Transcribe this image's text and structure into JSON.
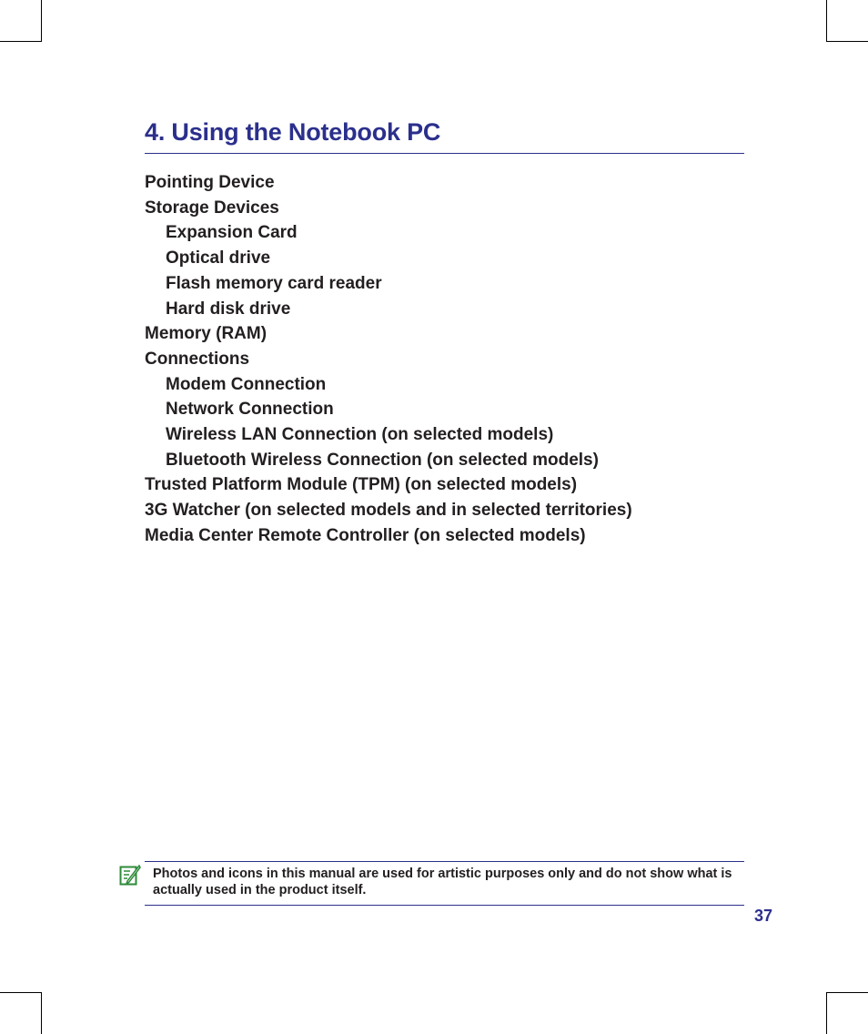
{
  "page": {
    "chapter_title": "4. Using the Notebook PC",
    "toc": [
      {
        "label": "Pointing Device",
        "level": 1
      },
      {
        "label": "Storage Devices",
        "level": 1
      },
      {
        "label": "Expansion Card",
        "level": 2
      },
      {
        "label": "Optical drive",
        "level": 2
      },
      {
        "label": "Flash memory card reader",
        "level": 2
      },
      {
        "label": "Hard disk drive",
        "level": 2
      },
      {
        "label": "Memory (RAM)",
        "level": 1
      },
      {
        "label": "Connections",
        "level": 1
      },
      {
        "label": "Modem Connection",
        "level": 2
      },
      {
        "label": "Network Connection",
        "level": 2
      },
      {
        "label": "Wireless LAN Connection (on selected models)",
        "level": 2
      },
      {
        "label": "Bluetooth Wireless Connection (on selected models)",
        "level": 2
      },
      {
        "label": "Trusted Platform Module (TPM) (on selected models)",
        "level": 1
      },
      {
        "label": "3G Watcher (on selected models and in selected territories)",
        "level": 1
      },
      {
        "label": "Media Center Remote Controller (on selected models)",
        "level": 1
      }
    ],
    "note": {
      "icon": "note-pencil-icon",
      "text": "Photos and icons in this manual are used for artistic purposes only and do not show what is actually used in the product itself."
    },
    "page_number": "37",
    "colors": {
      "accent": "#2b2f8c",
      "body_text": "#231f20",
      "note_icon": "#2e8b3a"
    }
  }
}
